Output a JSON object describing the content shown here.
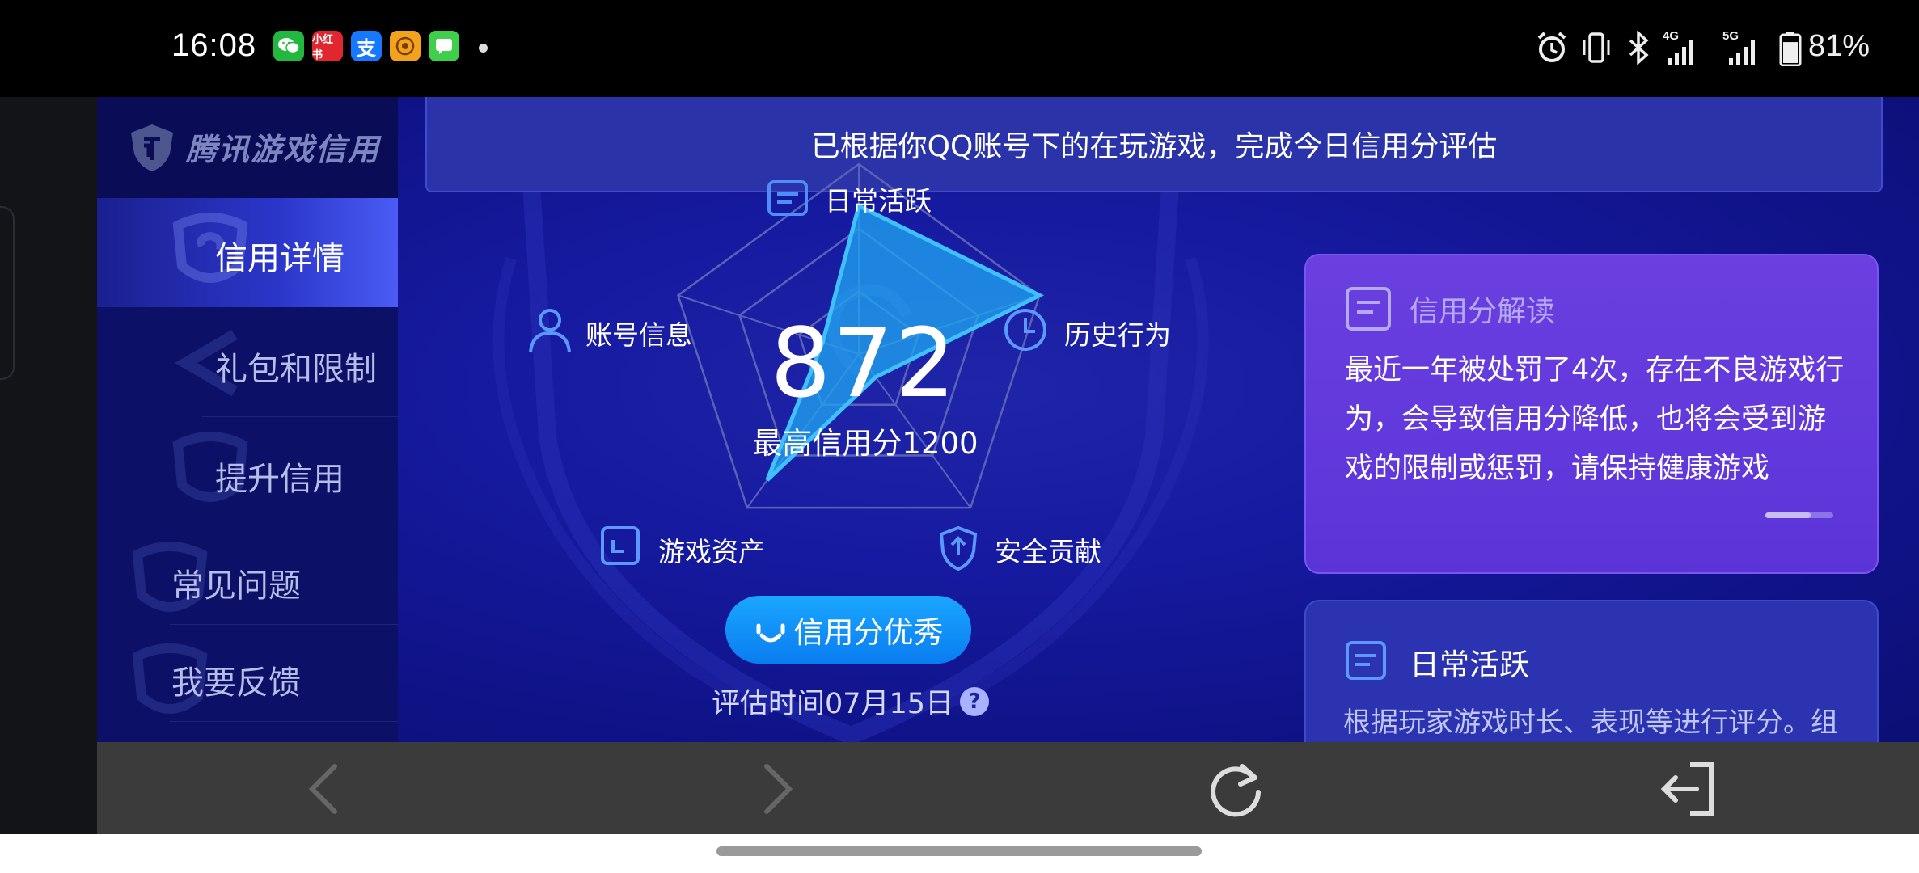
{
  "status_bar": {
    "time": "16:08",
    "notification_icons": [
      "wechat-icon",
      "xiaohongshu-icon",
      "alipay-icon",
      "game-icon",
      "messages-icon"
    ],
    "xiaohongshu_label": "小红书",
    "alipay_label": "支",
    "network_4g": "4G",
    "network_5g": "5G",
    "battery_percent": "81%",
    "battery_level": 0.81
  },
  "sidebar": {
    "logo_text": "腾讯游戏信用",
    "items": [
      {
        "label": "信用详情",
        "active": true
      },
      {
        "label": "礼包和限制",
        "active": false
      },
      {
        "label": "提升信用",
        "active": false
      },
      {
        "label": "常见问题",
        "active": false
      },
      {
        "label": "我要反馈",
        "active": false
      }
    ]
  },
  "banner": {
    "text": "已根据你QQ账号下的在玩游戏，完成今日信用分评估"
  },
  "radar": {
    "labels": {
      "daily": "日常活跃",
      "account": "账号信息",
      "history": "历史行为",
      "assets": "游戏资产",
      "security": "安全贡献"
    },
    "score": "872",
    "max_label": "最高信用分1200",
    "values": {
      "daily": 0.78,
      "history": 1.0,
      "security": 0.15,
      "assets": 0.82,
      "account": 0.2
    }
  },
  "rating_button": {
    "label": "信用分优秀"
  },
  "eval_time": {
    "text": "评估时间07月15日",
    "help": "?"
  },
  "explain_card": {
    "title": "信用分解读",
    "body": "最近一年被处罚了4次，存在不良游戏行为，会导致信用分降低，也将会受到游戏的限制或惩罚，请保持健康游戏"
  },
  "daily_card": {
    "title": "日常活跃",
    "body": "根据玩家游戏时长、表现等进行评分。组"
  },
  "colors": {
    "page_bg": "#10137a",
    "accent_blue": "#0a7df0",
    "card_purple": "#5b34d8",
    "radar_fill": "#1fa3f0"
  }
}
